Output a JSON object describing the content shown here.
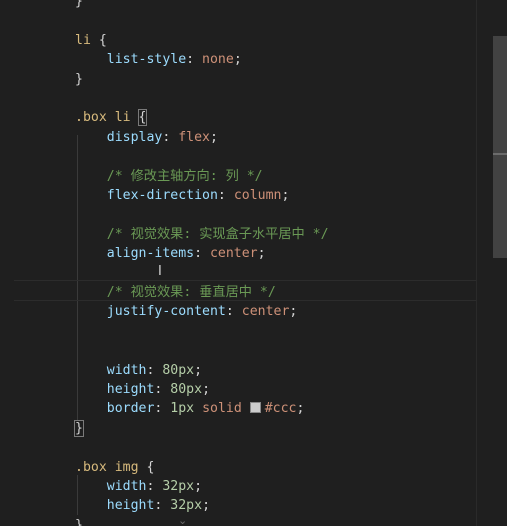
{
  "editor": {
    "lines": [
      {
        "tokens": [
          {
            "t": "}",
            "c": "punct"
          }
        ]
      },
      {
        "tokens": []
      },
      {
        "tokens": [
          {
            "t": "li ",
            "c": "sel"
          },
          {
            "t": "{",
            "c": "punct"
          }
        ]
      },
      {
        "tokens": [
          {
            "t": "    list-style",
            "c": "prop"
          },
          {
            "t": ": ",
            "c": "punct"
          },
          {
            "t": "none",
            "c": "val"
          },
          {
            "t": ";",
            "c": "punct"
          }
        ]
      },
      {
        "tokens": [
          {
            "t": "}",
            "c": "punct"
          }
        ]
      },
      {
        "tokens": []
      },
      {
        "tokens": [
          {
            "t": ".box li ",
            "c": "sel"
          },
          {
            "t": "{",
            "c": "brace-hl"
          }
        ]
      },
      {
        "tokens": [
          {
            "t": "    display",
            "c": "prop"
          },
          {
            "t": ": ",
            "c": "punct"
          },
          {
            "t": "flex",
            "c": "val"
          },
          {
            "t": ";",
            "c": "punct"
          }
        ]
      },
      {
        "tokens": []
      },
      {
        "tokens": [
          {
            "t": "    /* 修改主轴方向: 列 */",
            "c": "comment"
          }
        ]
      },
      {
        "tokens": [
          {
            "t": "    flex-direction",
            "c": "prop"
          },
          {
            "t": ": ",
            "c": "punct"
          },
          {
            "t": "column",
            "c": "val"
          },
          {
            "t": ";",
            "c": "punct"
          }
        ]
      },
      {
        "tokens": []
      },
      {
        "tokens": [
          {
            "t": "    /* 视觉效果: 实现盒子水平居中 */",
            "c": "comment"
          }
        ]
      },
      {
        "tokens": [
          {
            "t": "    align-items",
            "c": "prop"
          },
          {
            "t": ": ",
            "c": "punct"
          },
          {
            "t": "center",
            "c": "val"
          },
          {
            "t": ";",
            "c": "punct"
          }
        ]
      },
      {
        "tokens": []
      },
      {
        "tokens": [
          {
            "t": "    /* 视觉效果: 垂直居中 */",
            "c": "comment"
          }
        ]
      },
      {
        "tokens": [
          {
            "t": "    justify-content",
            "c": "prop"
          },
          {
            "t": ": ",
            "c": "punct"
          },
          {
            "t": "center",
            "c": "val"
          },
          {
            "t": ";",
            "c": "punct"
          }
        ]
      },
      {
        "tokens": []
      },
      {
        "tokens": []
      },
      {
        "tokens": [
          {
            "t": "    width",
            "c": "prop"
          },
          {
            "t": ": ",
            "c": "punct"
          },
          {
            "t": "80px",
            "c": "num"
          },
          {
            "t": ";",
            "c": "punct"
          }
        ]
      },
      {
        "tokens": [
          {
            "t": "    height",
            "c": "prop"
          },
          {
            "t": ": ",
            "c": "punct"
          },
          {
            "t": "80px",
            "c": "num"
          },
          {
            "t": ";",
            "c": "punct"
          }
        ]
      },
      {
        "tokens": [
          {
            "t": "    border",
            "c": "prop"
          },
          {
            "t": ": ",
            "c": "punct"
          },
          {
            "t": "1px ",
            "c": "num"
          },
          {
            "t": "solid ",
            "c": "val"
          },
          {
            "t": "",
            "c": "swatch"
          },
          {
            "t": "#ccc",
            "c": "val"
          },
          {
            "t": ";",
            "c": "punct"
          }
        ]
      },
      {
        "tokens": [
          {
            "t": "}",
            "c": "brace-hl"
          }
        ]
      },
      {
        "tokens": []
      },
      {
        "tokens": [
          {
            "t": ".box img ",
            "c": "sel"
          },
          {
            "t": "{",
            "c": "punct"
          }
        ]
      },
      {
        "tokens": [
          {
            "t": "    width",
            "c": "prop"
          },
          {
            "t": ": ",
            "c": "punct"
          },
          {
            "t": "32px",
            "c": "num"
          },
          {
            "t": ";",
            "c": "punct"
          }
        ]
      },
      {
        "tokens": [
          {
            "t": "    height",
            "c": "prop"
          },
          {
            "t": ": ",
            "c": "punct"
          },
          {
            "t": "32px",
            "c": "num"
          },
          {
            "t": ";",
            "c": "punct"
          }
        ]
      },
      {
        "tokens": [
          {
            "t": "}",
            "c": "punct"
          }
        ]
      }
    ]
  },
  "colors": {
    "selector": "#d7ba7d",
    "property": "#9cdcfe",
    "value": "#ce9178",
    "number": "#b5cea8",
    "comment": "#6a9955",
    "swatch": "#cccccc"
  },
  "icons": {
    "text_cursor": "I-beam",
    "swatch": "color-swatch"
  }
}
